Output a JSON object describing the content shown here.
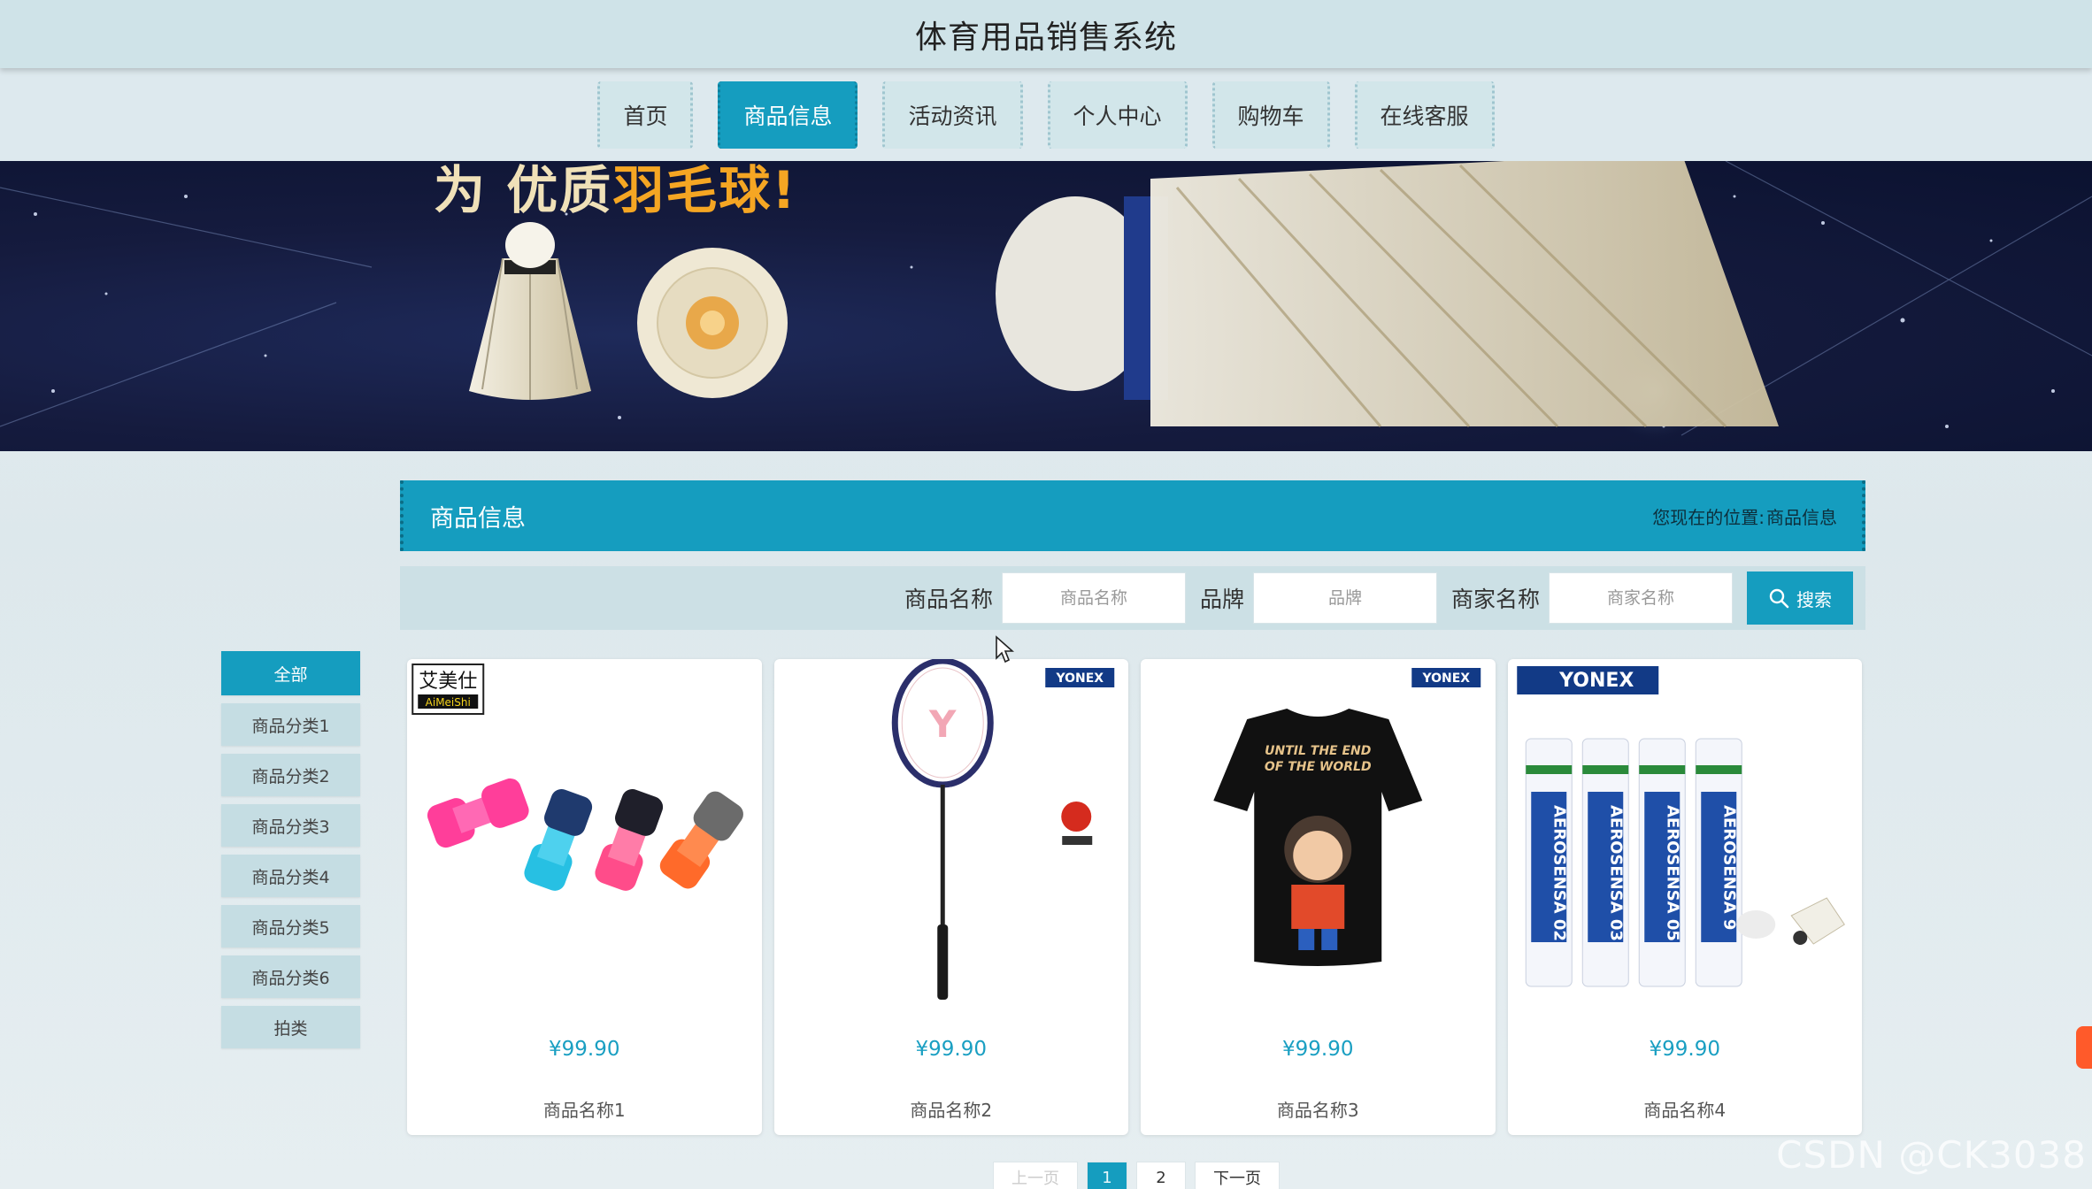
{
  "header": {
    "title": "体育用品销售系统"
  },
  "nav": {
    "items": [
      {
        "label": "首页",
        "active": false
      },
      {
        "label": "商品信息",
        "active": true
      },
      {
        "label": "活动资讯",
        "active": false
      },
      {
        "label": "个人中心",
        "active": false
      },
      {
        "label": "购物车",
        "active": false
      },
      {
        "label": "在线客服",
        "active": false
      }
    ]
  },
  "banner": {
    "text_a": "为",
    "text_b": "优质",
    "text_c": "羽毛球!"
  },
  "panel": {
    "title": "商品信息",
    "breadcrumb_prefix": "您现在的位置:",
    "breadcrumb_current": "商品信息"
  },
  "search": {
    "name_label": "商品名称",
    "name_placeholder": "商品名称",
    "brand_label": "品牌",
    "brand_placeholder": "品牌",
    "merchant_label": "商家名称",
    "merchant_placeholder": "商家名称",
    "button_label": "搜索"
  },
  "categories": [
    {
      "label": "全部",
      "active": true
    },
    {
      "label": "商品分类1"
    },
    {
      "label": "商品分类2"
    },
    {
      "label": "商品分类3"
    },
    {
      "label": "商品分类4"
    },
    {
      "label": "商品分类5"
    },
    {
      "label": "商品分类6"
    },
    {
      "label": "拍类"
    }
  ],
  "products": [
    {
      "price": "¥99.90",
      "name": "商品名称1",
      "brand": "艾美仕",
      "brand_sub": "AiMeiShi",
      "image": "dumbbells"
    },
    {
      "price": "¥99.90",
      "name": "商品名称2",
      "brand": "YONEX",
      "image": "racket"
    },
    {
      "price": "¥99.90",
      "name": "商品名称3",
      "brand": "YONEX",
      "tshirt_text": "UNTIL THE END OF THE WORLD",
      "image": "t-shirt"
    },
    {
      "price": "¥99.90",
      "name": "商品名称4",
      "brand": "YONEX",
      "tube_labels": [
        "AEROSENSA 02",
        "AEROSENSA 03",
        "AEROSENSA 05",
        "AEROSENSA 9"
      ],
      "image": "shuttlecock-tubes"
    }
  ],
  "pagination": {
    "prev": "上一页",
    "pages": [
      "1",
      "2"
    ],
    "current": "1",
    "next": "下一页"
  },
  "watermark": "CSDN @CK3038",
  "colors": {
    "accent": "#159dbf",
    "header_bg": "#cfe3e8",
    "price": "#1a9fc2"
  }
}
